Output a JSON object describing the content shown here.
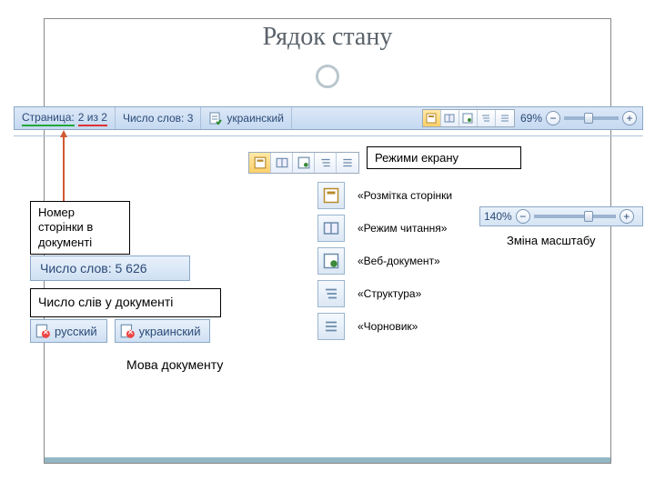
{
  "title": "Рядок стану",
  "statusbar": {
    "page_label": "Страница:",
    "page_value": "2 из 2",
    "words_label": "Число слов:",
    "words_value": "3",
    "language": "украинский",
    "zoom": "69%"
  },
  "center": {
    "modes_header": "Режими екрану",
    "modes": [
      "«Розмітка сторінки",
      "«Режим читання»",
      "«Веб-документ»",
      "«Структура»",
      "«Чорновик»"
    ]
  },
  "left": {
    "pagenum_box": "Номер сторінки в документі",
    "wordcount_chip": "Число слов: 5 626",
    "wordcount_label": "Число слів у документі",
    "lang_ru": "русский",
    "lang_uk": "украинский",
    "lang_label": "Мова документу"
  },
  "right": {
    "zoom_strip": "140%",
    "zoom_label": "Зміна масштабу"
  },
  "icons": {
    "print_layout": "print-layout-icon",
    "reading": "reading-icon",
    "web": "web-icon",
    "outline": "outline-icon",
    "draft": "draft-icon",
    "spellcheck": "spellcheck-icon",
    "minus": "−",
    "plus": "+"
  },
  "colors": {
    "accent": "#5a626a",
    "bar_bg": "#cfe0f3",
    "link": "#2b4a77"
  }
}
